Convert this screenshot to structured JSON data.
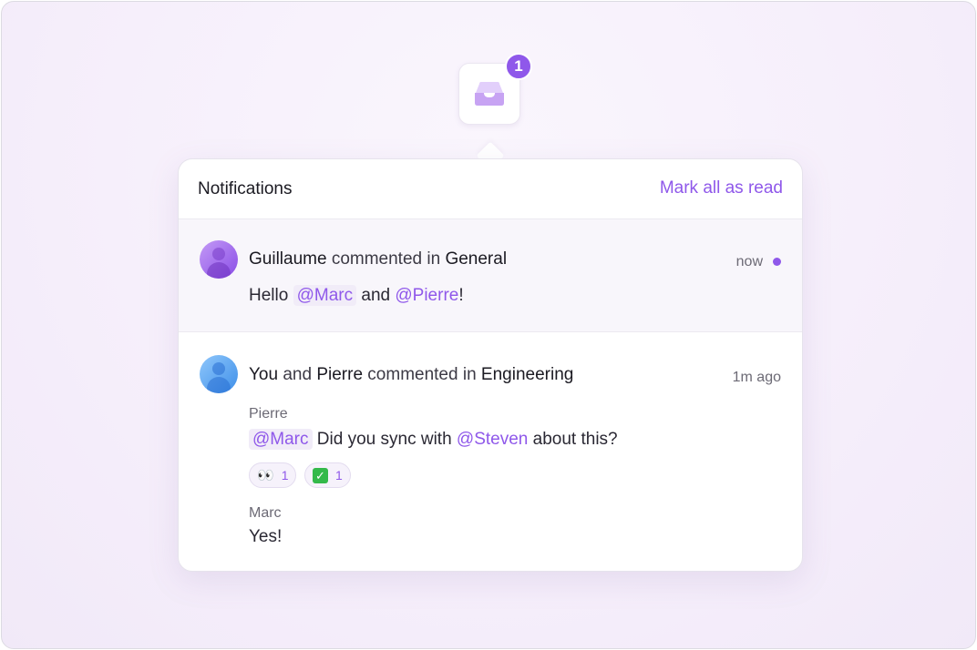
{
  "badge_count": "1",
  "icons": {
    "inbox": "inbox-tray-icon"
  },
  "colors": {
    "accent": "#8f58ea",
    "unread_bg": "#f8f6fb"
  },
  "header": {
    "title": "Notifications",
    "mark_all_read": "Mark all as read"
  },
  "notifications": [
    {
      "actor": "Guillaume",
      "verb": "commented in",
      "channel": "General",
      "time": "now",
      "unread": true,
      "message": {
        "prefix": "Hello",
        "mention1": "@Marc",
        "middle": "and",
        "mention2": "@Pierre",
        "suffix": "!"
      }
    },
    {
      "actor1": "You",
      "conj": "and",
      "actor2": "Pierre",
      "verb": "commented in",
      "channel": "Engineering",
      "time": "1m ago",
      "unread": false,
      "comments": [
        {
          "author": "Pierre",
          "mention1": "@Marc",
          "text_mid": "Did you sync with",
          "mention2": "@Steven",
          "text_end": "about this?",
          "reactions": [
            {
              "emoji": "👀",
              "count": "1"
            },
            {
              "emoji": "✅",
              "count": "1"
            }
          ]
        },
        {
          "author": "Marc",
          "text": "Yes!"
        }
      ]
    }
  ]
}
